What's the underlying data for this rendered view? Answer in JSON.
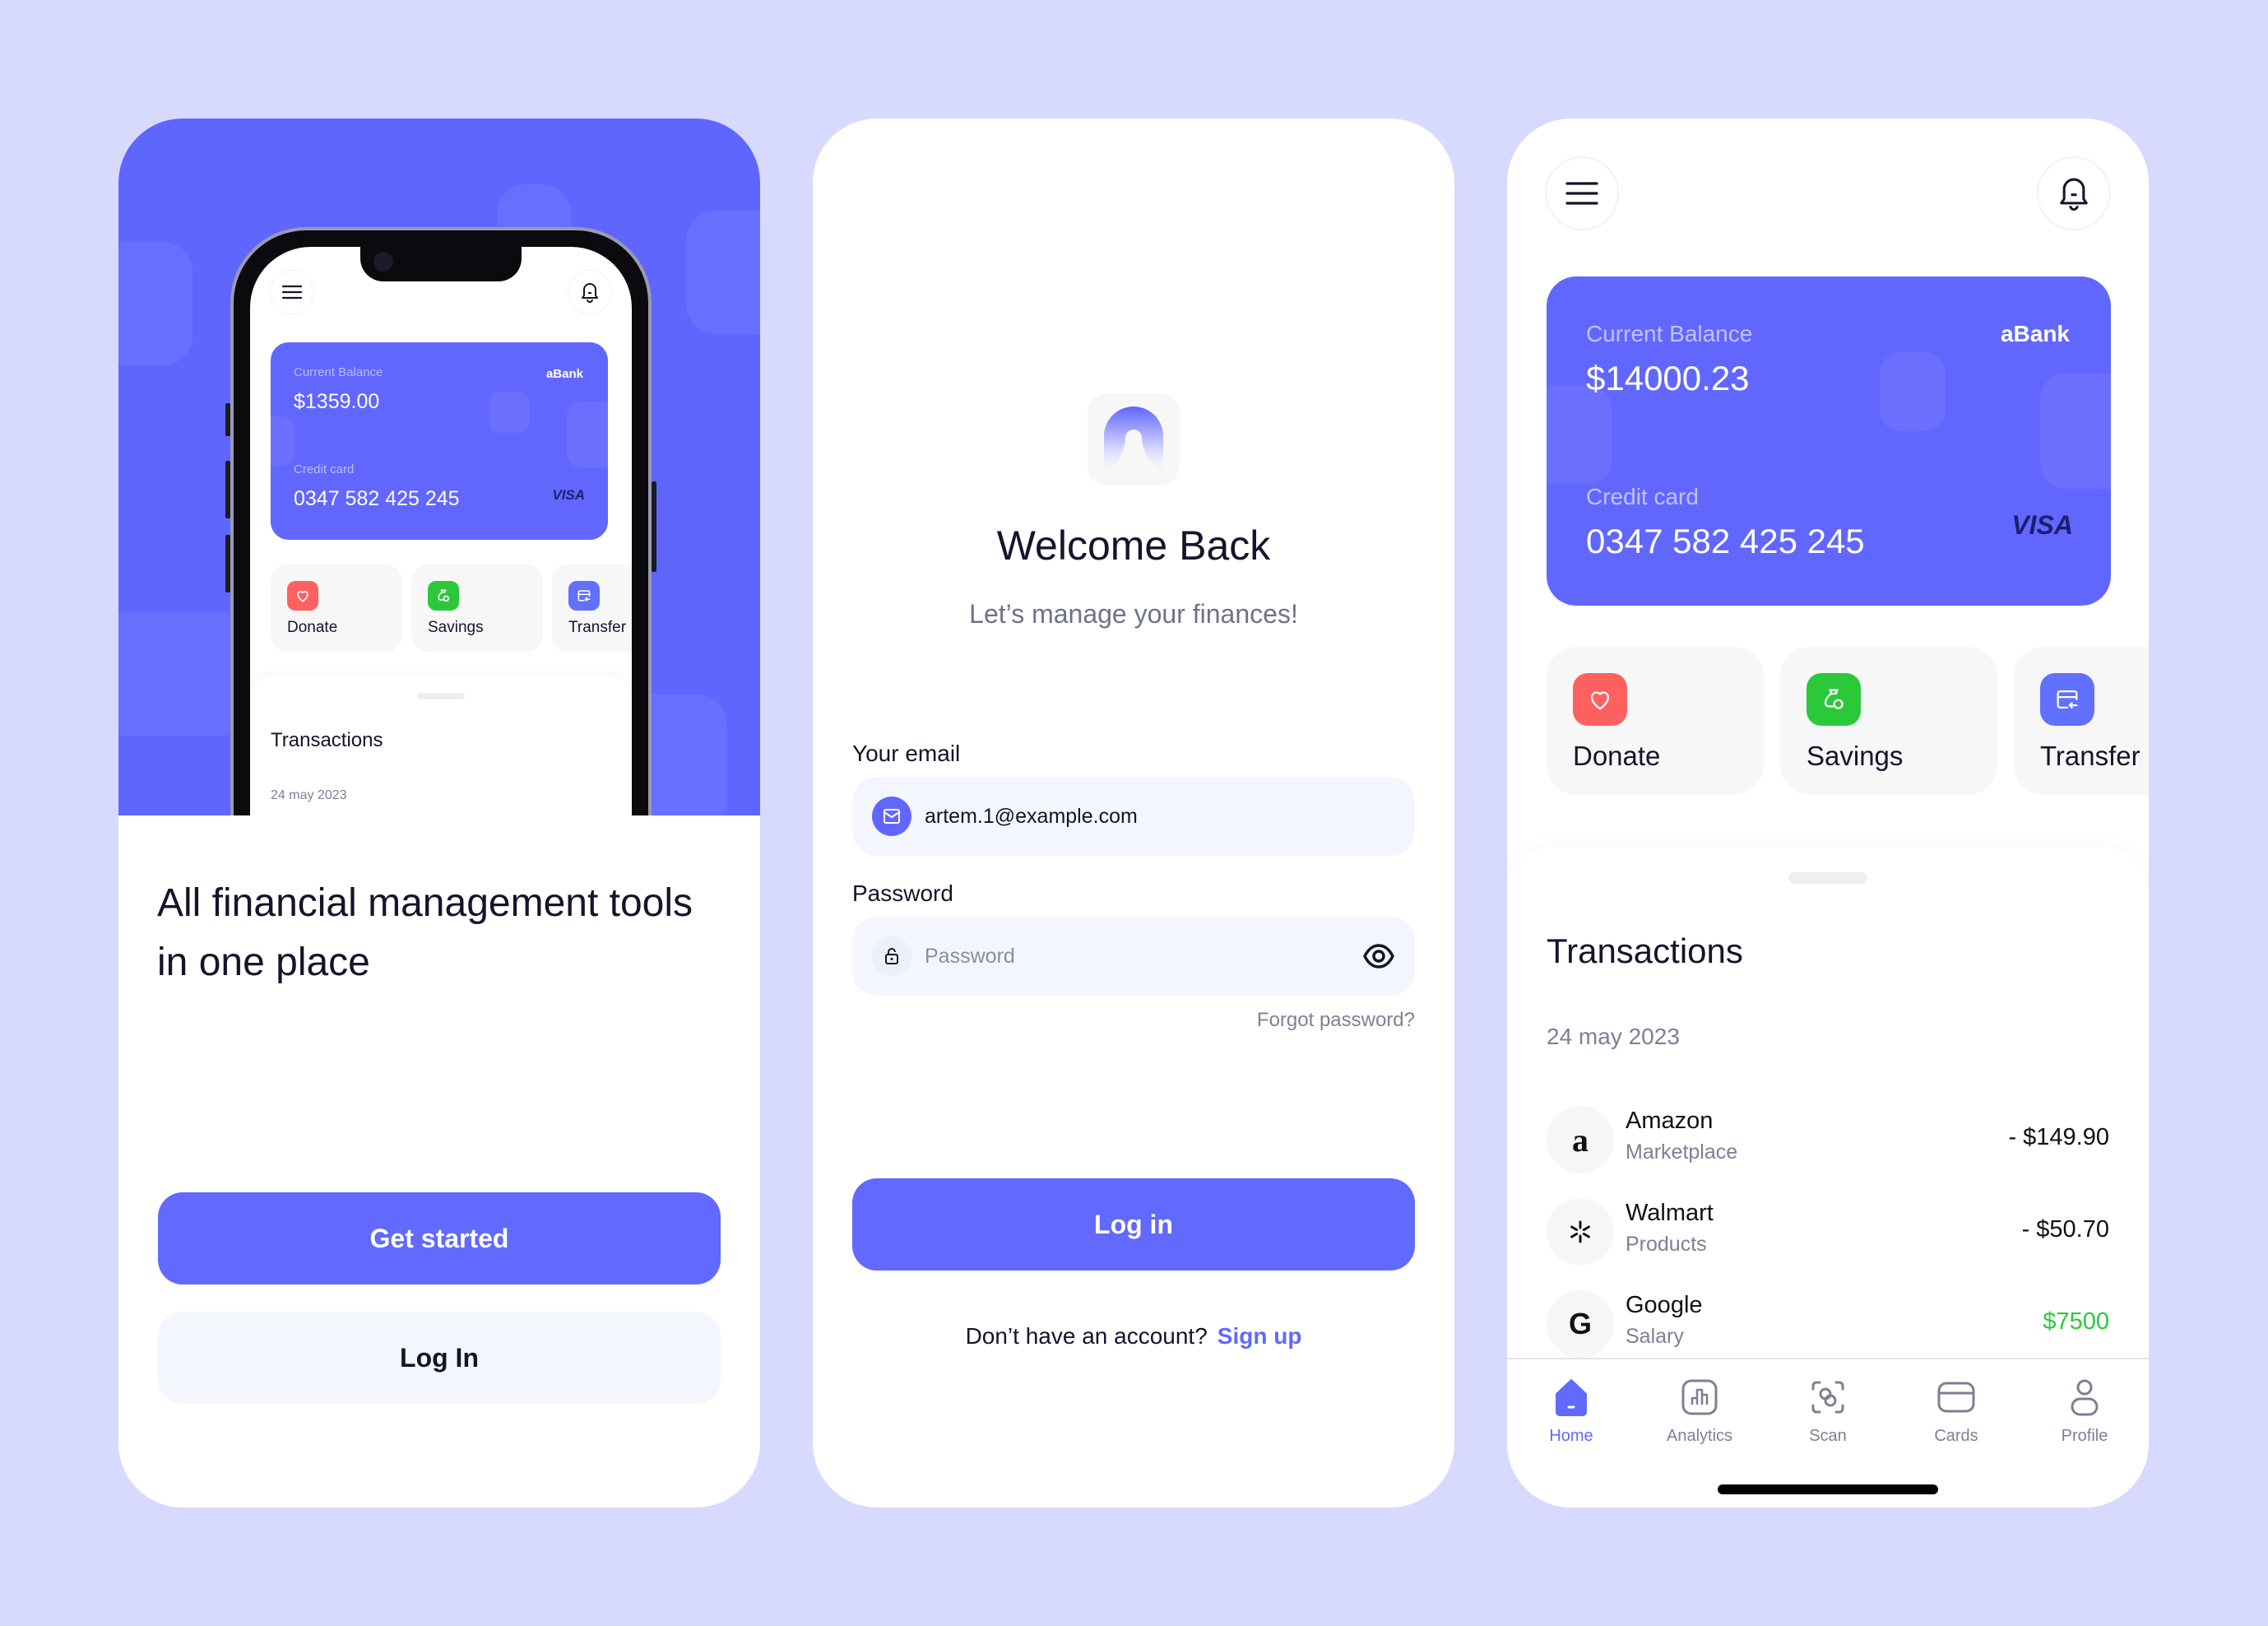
{
  "colors": {
    "background": "#D8D9FE",
    "accent": "#5F66FE",
    "donate": "#FF6161",
    "savings": "#2BC93A",
    "transfer": "#6170FE",
    "income": "#2BC93A"
  },
  "onboarding": {
    "mockup": {
      "card": {
        "balance_label": "Current Balance",
        "balance": "$1359.00",
        "bank": "aBank",
        "card_label": "Credit card",
        "card_number": "0347 582 425 245",
        "network": "VISA"
      },
      "actions": [
        {
          "label": "Donate",
          "icon": "heart-icon"
        },
        {
          "label": "Savings",
          "icon": "money-bag-icon"
        },
        {
          "label": "Transfer",
          "icon": "card-transfer-icon"
        }
      ],
      "transactions_title": "Transactions",
      "date": "24 may 2023"
    },
    "heading": "All financial management tools in one place",
    "get_started_label": "Get started",
    "login_label": "Log In"
  },
  "login": {
    "title": "Welcome Back",
    "subtitle": "Let’s manage your finances!",
    "email_label": "Your email",
    "email_value": "artem.1@example.com",
    "password_label": "Password",
    "password_placeholder": "Password",
    "forgot_label": "Forgot password?",
    "login_button": "Log in",
    "signup_prompt": "Don’t have an account?",
    "signup_link": "Sign up"
  },
  "home": {
    "card": {
      "balance_label": "Current Balance",
      "balance": "$14000.23",
      "bank": "aBank",
      "card_label": "Credit card",
      "card_number": "0347 582 425 245",
      "network": "VISA"
    },
    "actions": [
      {
        "label": "Donate",
        "icon": "heart-icon"
      },
      {
        "label": "Savings",
        "icon": "money-bag-icon"
      },
      {
        "label": "Transfer",
        "icon": "card-transfer-icon"
      }
    ],
    "transactions_title": "Transactions",
    "date": "24 may 2023",
    "transactions": [
      {
        "name": "Amazon",
        "category": "Marketplace",
        "amount": "- $149.90",
        "logo": "a",
        "type": "expense"
      },
      {
        "name": "Walmart",
        "category": "Products",
        "amount": "- $50.70",
        "logo": "*",
        "type": "expense"
      },
      {
        "name": "Google",
        "category": "Salary",
        "amount": "$7500",
        "logo": "G",
        "type": "income"
      }
    ],
    "tabs": [
      {
        "label": "Home",
        "icon": "home-icon",
        "active": true
      },
      {
        "label": "Analytics",
        "icon": "analytics-icon",
        "active": false
      },
      {
        "label": "Scan",
        "icon": "scan-icon",
        "active": false
      },
      {
        "label": "Cards",
        "icon": "cards-icon",
        "active": false
      },
      {
        "label": "Profile",
        "icon": "profile-icon",
        "active": false
      }
    ]
  }
}
